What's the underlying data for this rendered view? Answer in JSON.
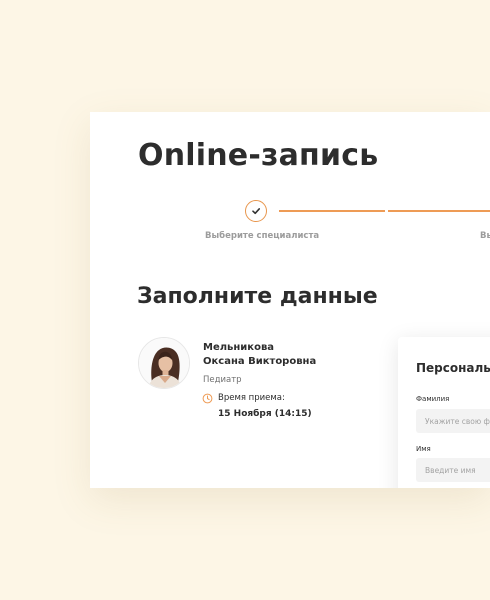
{
  "page": {
    "title": "Online-запись",
    "section_title": "Заполните данные"
  },
  "steps": [
    {
      "label": "Выберите специалиста",
      "status": "completed",
      "icon": "check-icon"
    },
    {
      "label": "Выберите время",
      "status": "pending"
    }
  ],
  "doctor": {
    "last_name": "Мельникова",
    "first_patronymic": "Оксана Викторовна",
    "specialty": "Педиатр",
    "time_label": "Время приема:",
    "time_value": "15 Ноября (14:15)",
    "avatar_icon": "doctor-photo",
    "time_icon": "clock-icon"
  },
  "form": {
    "title": "Персональные данные",
    "fields": [
      {
        "label": "Фамилия",
        "placeholder": "Укажите свою фамилию",
        "value": ""
      },
      {
        "label": "Имя",
        "placeholder": "Введите имя",
        "value": ""
      }
    ]
  },
  "colors": {
    "background": "#fdf6e6",
    "accent": "#ee9b55",
    "text": "#2d2d2d",
    "muted": "#9c9c9c"
  }
}
